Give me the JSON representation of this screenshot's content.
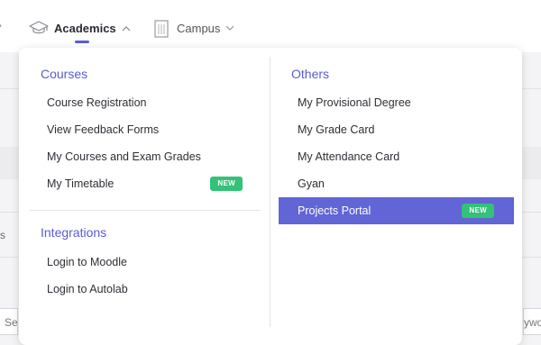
{
  "navbar": {
    "items": [
      {
        "label": "Academics",
        "icon": "graduation-cap-icon",
        "expanded": true
      },
      {
        "label": "Campus",
        "icon": "building-icon",
        "expanded": false
      }
    ],
    "accent_color": "#5b5bd6"
  },
  "dropdown": {
    "columns": [
      {
        "sections": [
          {
            "title": "Courses",
            "items": [
              {
                "label": "Course Registration"
              },
              {
                "label": "View Feedback Forms"
              },
              {
                "label": "My Courses and Exam Grades"
              },
              {
                "label": "My Timetable",
                "badge": "NEW"
              }
            ]
          },
          {
            "title": "Integrations",
            "items": [
              {
                "label": "Login to Moodle"
              },
              {
                "label": "Login to Autolab"
              }
            ]
          }
        ]
      },
      {
        "sections": [
          {
            "title": "Others",
            "items": [
              {
                "label": "My Provisional Degree"
              },
              {
                "label": "My Grade Card"
              },
              {
                "label": "My Attendance Card"
              },
              {
                "label": "Gyan"
              },
              {
                "label": "Projects Portal",
                "badge": "NEW",
                "active": true
              }
            ]
          }
        ]
      }
    ],
    "active_color": "#6265d6",
    "badge_color": "#33c277"
  },
  "background": {
    "left_text_fragment": "s",
    "left_input_fragment": "Se",
    "right_input_fragment": "ywo"
  }
}
